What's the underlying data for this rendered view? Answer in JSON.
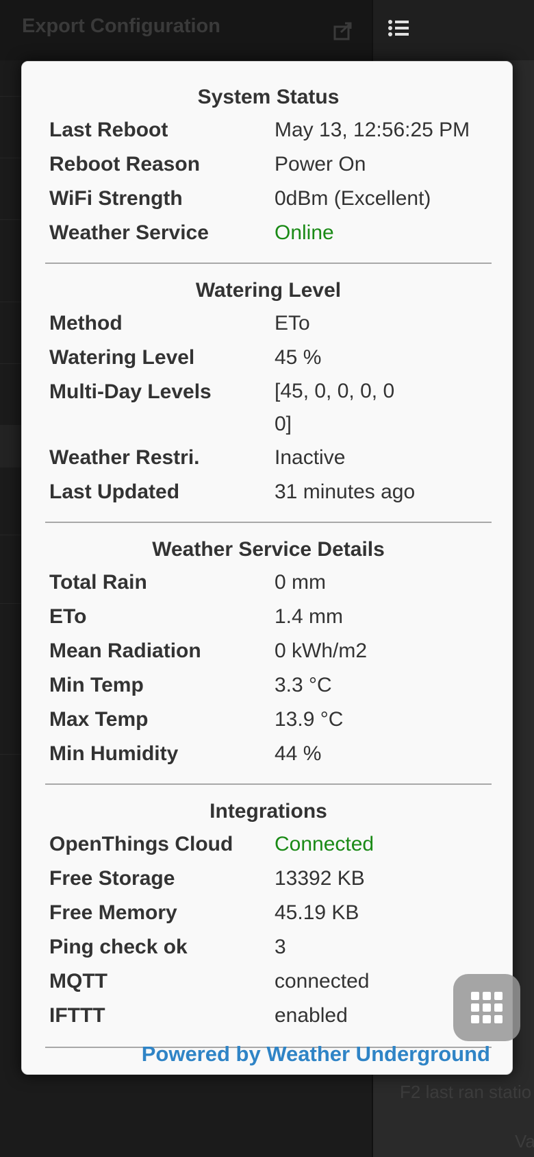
{
  "background": {
    "left_title": "Export Configuration",
    "right_fragment": "F2 last ran statio",
    "right_fragment2": "Va"
  },
  "sections": [
    {
      "title": "System Status",
      "rows": [
        {
          "label": "Last Reboot",
          "value": "May 13, 12:56:25 PM"
        },
        {
          "label": "Reboot Reason",
          "value": "Power On"
        },
        {
          "label": "WiFi Strength",
          "value": "0dBm (Excellent)"
        },
        {
          "label": "Weather Service",
          "value": "Online",
          "status": "good"
        }
      ]
    },
    {
      "title": "Watering Level",
      "rows": [
        {
          "label": "Method",
          "value": "ETo"
        },
        {
          "label": "Watering Level",
          "value": "45 %"
        },
        {
          "label": "Multi-Day Levels",
          "value": "[45, 0, 0, 0, 0 0]"
        },
        {
          "label": "Weather Restri.",
          "value": "Inactive"
        },
        {
          "label": "Last Updated",
          "value": "31 minutes ago"
        }
      ]
    },
    {
      "title": "Weather Service Details",
      "rows": [
        {
          "label": "Total Rain",
          "value": "0 mm"
        },
        {
          "label": "ETo",
          "value": "1.4 mm"
        },
        {
          "label": "Mean Radiation",
          "value": "0 kWh/m2"
        },
        {
          "label": "Min Temp",
          "value": "3.3 °C"
        },
        {
          "label": "Max Temp",
          "value": "13.9 °C"
        },
        {
          "label": "Min Humidity",
          "value": "44 %"
        }
      ]
    },
    {
      "title": "Integrations",
      "rows": [
        {
          "label": "OpenThings Cloud",
          "value": "Connected",
          "status": "good"
        },
        {
          "label": "Free Storage",
          "value": "13392 KB"
        },
        {
          "label": "Free Memory",
          "value": "45.19 KB"
        },
        {
          "label": "Ping check ok",
          "value": "3"
        },
        {
          "label": "MQTT",
          "value": "connected"
        },
        {
          "label": "IFTTT",
          "value": "enabled"
        }
      ]
    }
  ],
  "footer": {
    "link_text": "Powered by Weather Underground"
  },
  "colors": {
    "status_good": "#1a8a16",
    "link": "#2f84c6"
  },
  "icons": {
    "export": "export-icon",
    "menu": "list-menu-icon",
    "keypad": "keypad-grid-icon"
  }
}
